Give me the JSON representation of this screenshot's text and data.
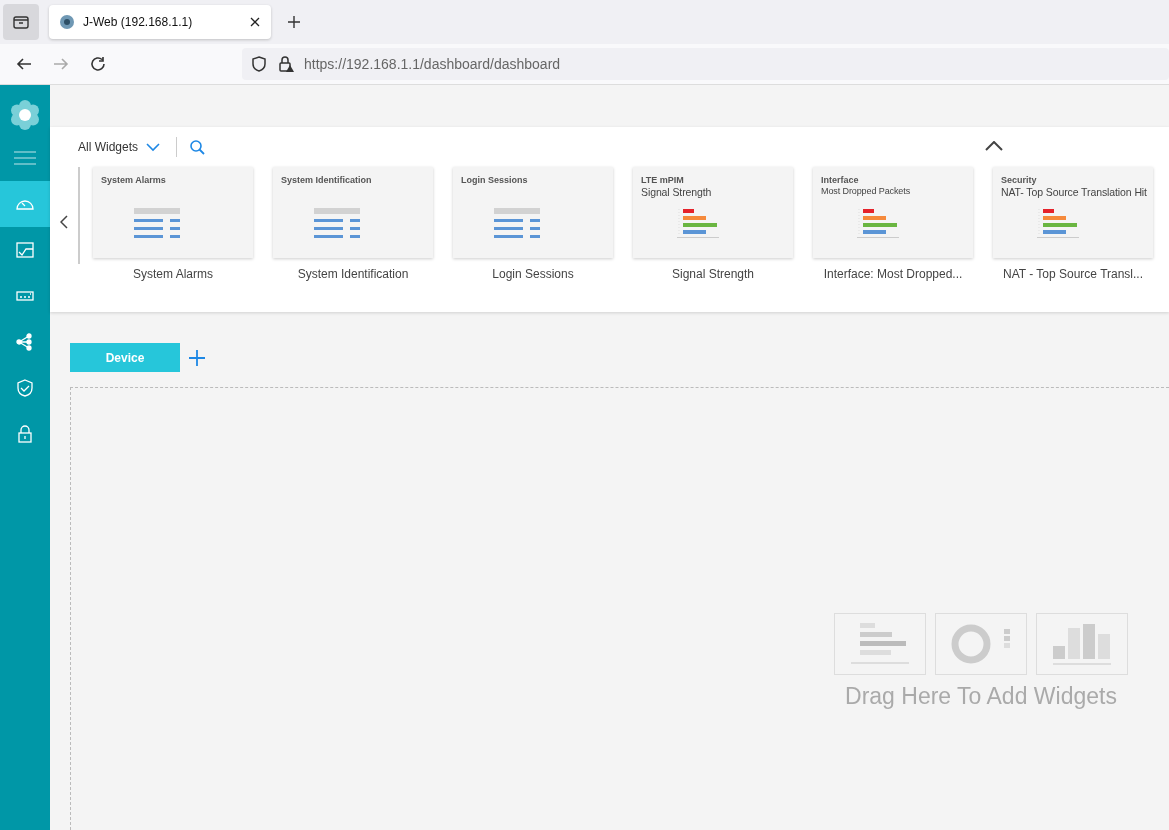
{
  "browser": {
    "tab_title": "J-Web (192.168.1.1)",
    "url_host": "https://192.168.1.1",
    "url_path": "/dashboard/dashboard"
  },
  "sidebar": {
    "items": [
      {
        "kind": "dashboard",
        "selected": true
      },
      {
        "kind": "monitor",
        "selected": false
      },
      {
        "kind": "device",
        "selected": false
      },
      {
        "kind": "network",
        "selected": false
      },
      {
        "kind": "security",
        "selected": false
      },
      {
        "kind": "lock",
        "selected": false
      }
    ]
  },
  "widget_bar": {
    "filter": "All Widgets",
    "widgets": [
      {
        "kind": "grid",
        "category": "System Alarms",
        "label": "System Alarms"
      },
      {
        "kind": "grid",
        "category": "System Identification",
        "label": "System Identification"
      },
      {
        "kind": "grid",
        "category": "Login Sessions",
        "label": "Login Sessions"
      },
      {
        "kind": "bars",
        "category": "LTE mPIM",
        "title": "Signal Strength",
        "title_small": false,
        "label": "Signal Strength"
      },
      {
        "kind": "bars",
        "category": "Interface",
        "title": "Most Dropped Packets",
        "title_small": true,
        "label": "Interface: Most Dropped..."
      },
      {
        "kind": "bars",
        "category": "Security",
        "title": "NAT- Top Source Translation Hit",
        "title_small": false,
        "label": "NAT - Top Source Transl..."
      }
    ]
  },
  "dashboard_tabs": [
    {
      "label": "Device",
      "selected": true
    }
  ],
  "drop_zone": {
    "hint": "Drag Here To Add Widgets"
  }
}
